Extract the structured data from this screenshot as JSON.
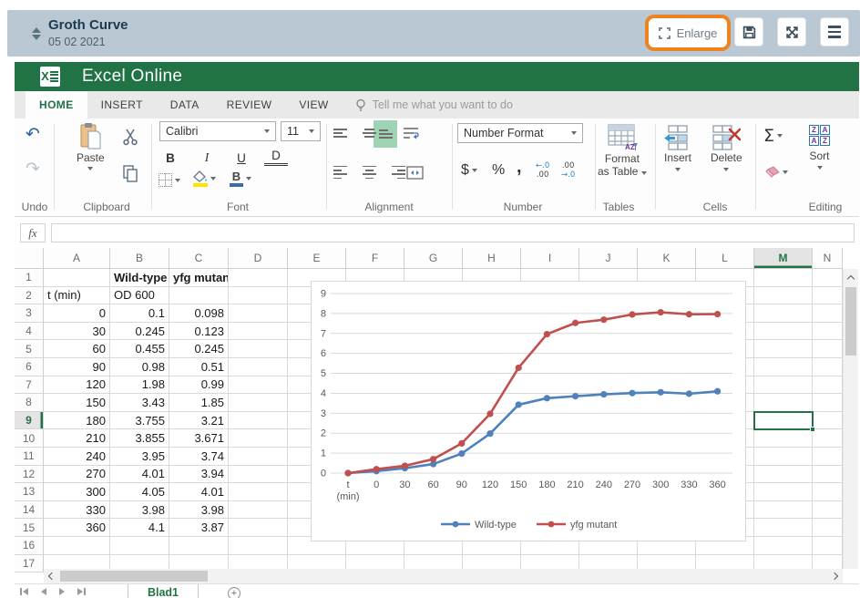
{
  "app": {
    "title": "Groth Curve",
    "date": "05 02 2021",
    "enlarge_label": "Enlarge"
  },
  "excel": {
    "brand": "Excel Online",
    "tabs": [
      "HOME",
      "INSERT",
      "DATA",
      "REVIEW",
      "VIEW"
    ],
    "active_tab": "HOME",
    "tell_me": "Tell me what you want to do",
    "ribbon": {
      "groups": {
        "undo": "Undo",
        "clipboard": "Clipboard",
        "font": "Font",
        "alignment": "Alignment",
        "number": "Number",
        "tables": "Tables",
        "cells": "Cells",
        "editing": "Editing"
      },
      "paste_label": "Paste",
      "font_name": "Calibri",
      "font_size": "11",
      "bold": "B",
      "italic": "I",
      "underline": "U",
      "double_underline": "D",
      "number_format": "Number Format",
      "currency": "$",
      "percent": "%",
      "comma": ",",
      "inc_decimal_top": "←.0",
      "inc_decimal_bottom": ".00",
      "dec_decimal_top": ".00",
      "dec_decimal_bottom": "→.0",
      "format_as_table_line1": "Format",
      "format_as_table_line2": "as Table",
      "insert_label": "Insert",
      "delete_label": "Delete",
      "autosum": "Σ",
      "sort_label": "Sort",
      "sort_icon_letters": [
        "Z",
        "A",
        "A",
        "Z"
      ],
      "table_icon_letters": [
        "A",
        "Z"
      ]
    },
    "formula_bar": {
      "fx": "fx",
      "value": ""
    },
    "sheet": {
      "columns": [
        "A",
        "B",
        "C",
        "D",
        "E",
        "F",
        "G",
        "H",
        "I",
        "J",
        "K",
        "L",
        "M",
        "N"
      ],
      "selected_column": "M",
      "selected_row": 9,
      "visible_rows": 17,
      "rows": [
        [
          "",
          "Wild-type",
          "yfg mutant"
        ],
        [
          "t (min)",
          "OD 600",
          ""
        ],
        [
          "0",
          "0.1",
          "0.098"
        ],
        [
          "30",
          "0.245",
          "0.123"
        ],
        [
          "60",
          "0.455",
          "0.245"
        ],
        [
          "90",
          "0.98",
          "0.51"
        ],
        [
          "120",
          "1.98",
          "0.99"
        ],
        [
          "150",
          "3.43",
          "1.85"
        ],
        [
          "180",
          "3.755",
          "3.21"
        ],
        [
          "210",
          "3.855",
          "3.671"
        ],
        [
          "240",
          "3.95",
          "3.74"
        ],
        [
          "270",
          "4.01",
          "3.94"
        ],
        [
          "300",
          "4.05",
          "4.01"
        ],
        [
          "330",
          "3.98",
          "3.98"
        ],
        [
          "360",
          "4.1",
          "3.87"
        ],
        [
          "",
          "",
          ""
        ],
        [
          "",
          "",
          ""
        ]
      ],
      "tab_name": "Blad1"
    }
  },
  "chart_data": {
    "type": "line",
    "stacked": true,
    "categories": [
      "t\n(min)",
      "0",
      "30",
      "60",
      "90",
      "120",
      "150",
      "180",
      "210",
      "240",
      "270",
      "300",
      "330",
      "360"
    ],
    "series": [
      {
        "name": "Wild-type",
        "color": "#4f81bd",
        "values": [
          0,
          0.1,
          0.245,
          0.455,
          0.98,
          1.98,
          3.43,
          3.755,
          3.855,
          3.95,
          4.01,
          4.05,
          3.98,
          4.1
        ]
      },
      {
        "name": "yfg mutant",
        "color": "#c0504d",
        "values": [
          0,
          0.098,
          0.123,
          0.245,
          0.51,
          0.99,
          1.85,
          3.21,
          3.671,
          3.74,
          3.94,
          4.01,
          3.98,
          3.87
        ]
      }
    ],
    "ylim": [
      0,
      9
    ],
    "yticks": [
      0,
      1,
      2,
      3,
      4,
      5,
      6,
      7,
      8,
      9
    ],
    "gridlines": true,
    "legend_position": "bottom"
  }
}
